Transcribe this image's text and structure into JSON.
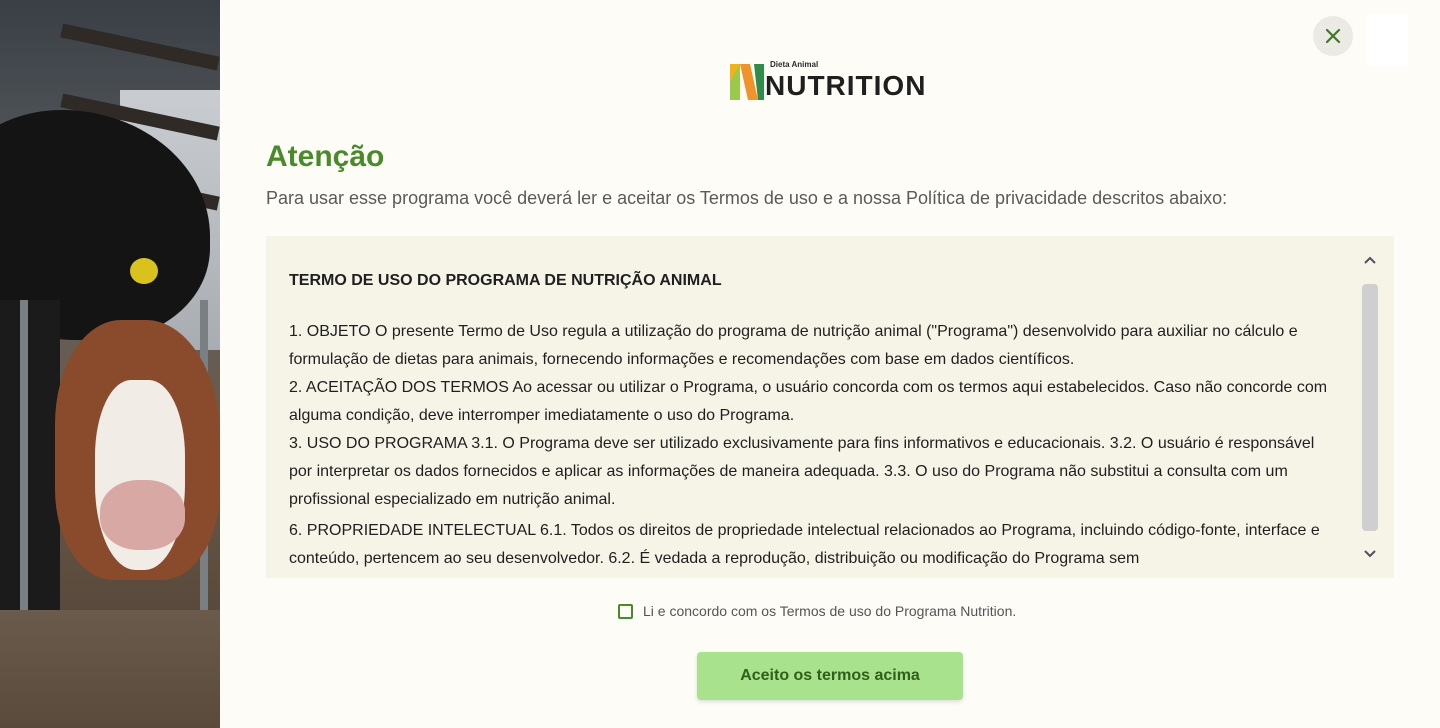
{
  "logo": {
    "small_text": "Dieta Animal",
    "big_text": "NUTRITION"
  },
  "header": {
    "title": "Atenção",
    "subtitle": "Para usar esse programa você deverá ler e aceitar os Termos de uso e a nossa Política de privacidade descritos abaixo:"
  },
  "terms": {
    "heading": "TERMO DE USO DO PROGRAMA DE NUTRIÇÃO ANIMAL",
    "paragraphs": [
      "1. OBJETO O presente Termo de Uso regula a utilização do programa de nutrição animal (\"Programa\") desenvolvido para auxiliar no cálculo e formulação de dietas para animais, fornecendo informações e recomendações com base em dados científicos.",
      "2. ACEITAÇÃO DOS TERMOS Ao acessar ou utilizar o Programa, o usuário concorda com os termos aqui estabelecidos. Caso não concorde com alguma condição, deve interromper imediatamente o uso do Programa.",
      "3. USO DO PROGRAMA 3.1. O Programa deve ser utilizado exclusivamente para fins informativos e educacionais. 3.2. O usuário é responsável por interpretar os dados fornecidos e aplicar as informações de maneira adequada. 3.3. O uso do Programa não substitui a consulta com um profissional especializado em nutrição animal.",
      "6. PROPRIEDADE INTELECTUAL 6.1. Todos os direitos de propriedade intelectual relacionados ao Programa, incluindo código-fonte, interface e conteúdo, pertencem ao seu desenvolvedor. 6.2. É vedada a reprodução, distribuição ou modificação do Programa sem"
    ]
  },
  "agreement": {
    "label": "Li e concordo com os Termos de uso do Programa Nutrition.",
    "checked": false
  },
  "accept_button": {
    "label": "Aceito os termos acima"
  },
  "icons": {
    "close": "close-icon",
    "scroll_up": "chevron-up-icon",
    "scroll_down": "chevron-down-icon"
  },
  "colors": {
    "accent": "#4a8a2a",
    "button_bg": "#a8e28c",
    "panel_bg": "#f6f4e7"
  }
}
